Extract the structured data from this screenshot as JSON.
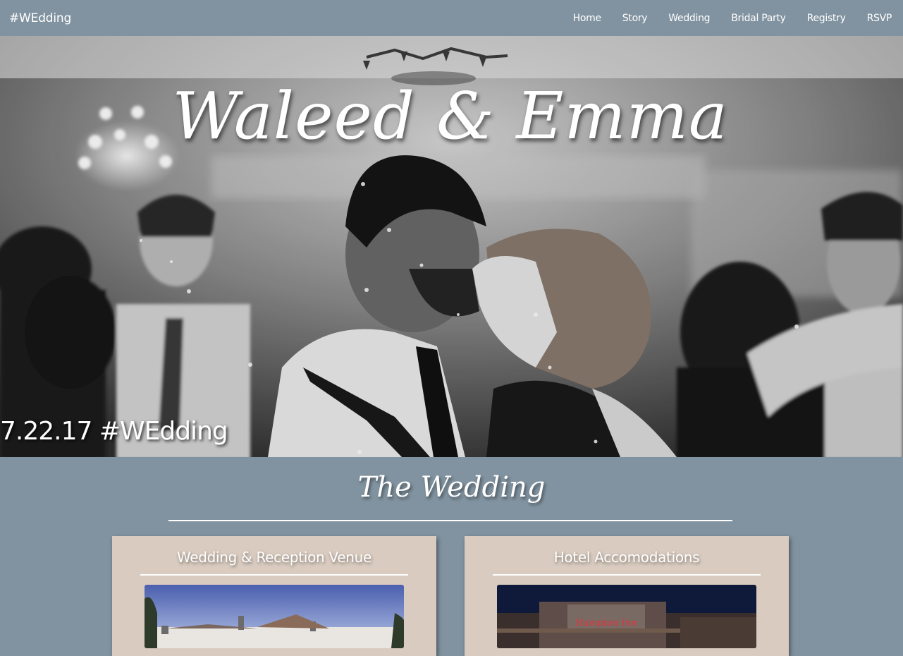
{
  "nav": {
    "brand": "#WEdding",
    "links": [
      "Home",
      "Story",
      "Wedding",
      "Bridal Party",
      "Registry",
      "RSVP"
    ]
  },
  "hero": {
    "title": "Waleed & Emma",
    "date_tag": "7.22.17 #WEdding",
    "image": "black-and-white photo of couple kissing on dance floor"
  },
  "section": {
    "title": "The Wedding",
    "cards": [
      {
        "title": "Wedding & Reception Venue",
        "image": "venue building photo"
      },
      {
        "title": "Hotel Accomodations",
        "image": "Hampton Inn hotel photo"
      }
    ]
  },
  "hotel_sign": "Hampton Inn",
  "colors": {
    "page_bg": "#8193a0",
    "card_bg": "#d9cbbf",
    "text": "#ffffff",
    "sign_red": "#e8303a"
  }
}
